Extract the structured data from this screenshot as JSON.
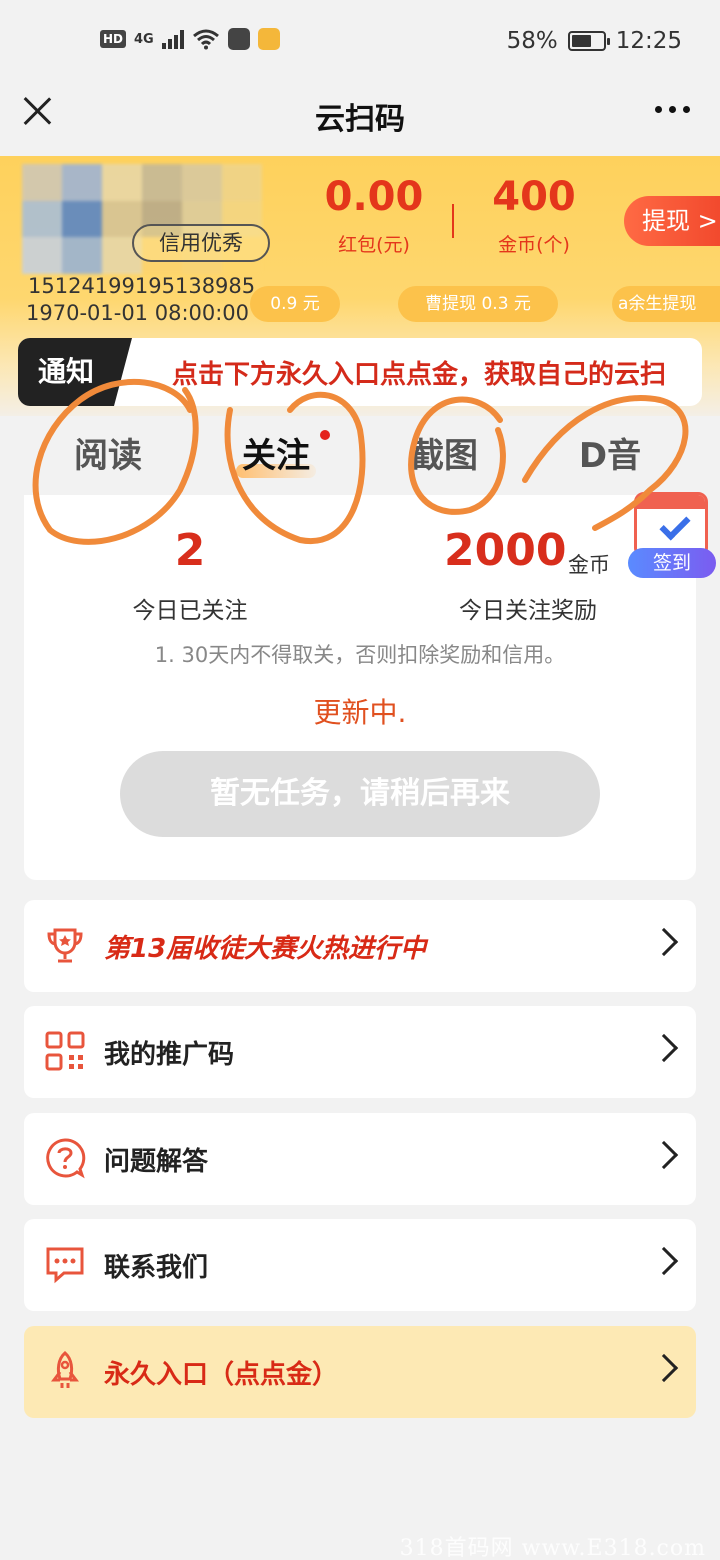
{
  "status_bar": {
    "hd": "HD",
    "network": "4G",
    "battery_percent": "58%",
    "time": "12:25"
  },
  "titlebar": {
    "title": "云扫码"
  },
  "profile": {
    "credit_badge": "信用优秀",
    "user_id": "15124199195138985",
    "register_time": "1970-01-01 08:00:00"
  },
  "stats": {
    "red_packet_value": "0.00",
    "red_packet_label": "红包(元)",
    "coins_value": "400",
    "coins_label": "金币(个)",
    "withdraw_label": "提现 >"
  },
  "ticker": [
    "0.9 元",
    "曹提现  0.3  元",
    "a余生提现"
  ],
  "notice": {
    "tag": "通知",
    "text": "点击下方永久入口点点金，获取自己的云扫"
  },
  "tabs": [
    {
      "label": "阅读",
      "active": false
    },
    {
      "label": "关注",
      "active": true
    },
    {
      "label": "截图",
      "active": false
    },
    {
      "label": "D音",
      "active": false
    }
  ],
  "task": {
    "followed_today": "2",
    "followed_today_label": "今日已关注",
    "reward_value": "2000",
    "reward_unit": "金币",
    "reward_label": "今日关注奖励",
    "rule": "1. 30天内不得取关，否则扣除奖励和信用。",
    "updating": "更新中.",
    "button": "暂无任务，请稍后再来"
  },
  "signin": {
    "label": "签到"
  },
  "menu": [
    {
      "label": "第13届收徒大赛火热进行中",
      "icon": "trophy-icon"
    },
    {
      "label": "我的推广码",
      "icon": "qr-code-icon"
    },
    {
      "label": "问题解答",
      "icon": "question-icon"
    },
    {
      "label": "联系我们",
      "icon": "chat-icon"
    },
    {
      "label": "永久入口（点点金）",
      "icon": "rocket-icon"
    }
  ],
  "watermark": "318首码网 www.E318.com",
  "colors": {
    "accent_red": "#e4361b",
    "header_yellow": "#fed15c",
    "menu_highlight": "#fde9b4"
  }
}
